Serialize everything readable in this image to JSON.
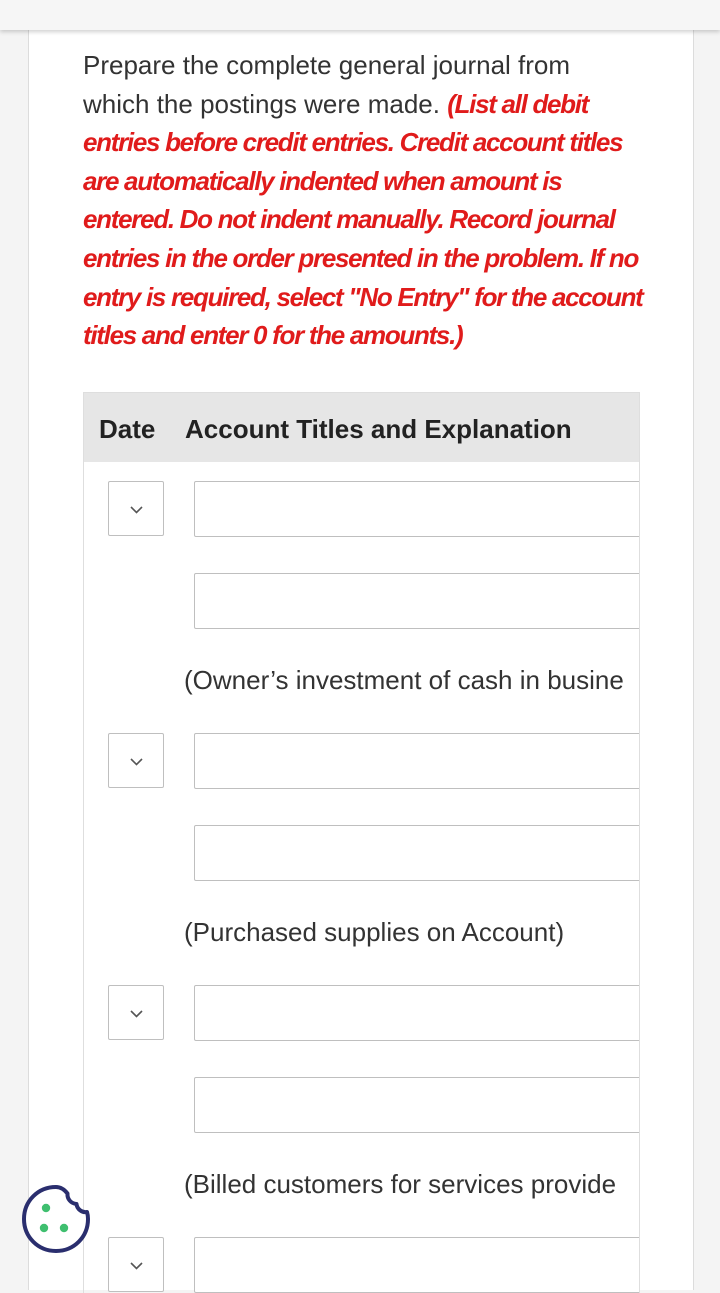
{
  "instructions": {
    "text": "Prepare the complete general journal from which the postings were made.",
    "note": "(List all debit entries before credit entries. Credit account titles are automatically indented when amount is entered. Do not indent manually. Record journal entries in the order presented in the problem. If no entry is required, select \"No Entry\" for the account titles and enter 0 for the amounts.)"
  },
  "table": {
    "headers": {
      "date": "Date",
      "account": "Account Titles and Explanation"
    },
    "entries": [
      {
        "explanation": "(Owner’s investment of cash in busine"
      },
      {
        "explanation": "(Purchased supplies on Account)"
      },
      {
        "explanation": "(Billed customers for services provide"
      }
    ]
  },
  "colors": {
    "note": "#e01b1b",
    "text": "#333333",
    "header_bg": "#e6e6e6",
    "cookie": "#2a2e6e",
    "cookie_dots": "#3fbf6f"
  },
  "icons": {
    "date_select": "chevron-down-icon",
    "cookie": "cookie-icon"
  }
}
